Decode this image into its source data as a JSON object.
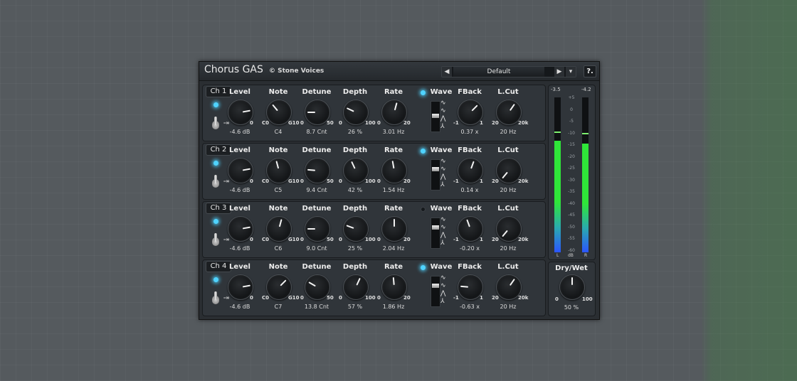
{
  "app": {
    "title": "Chorus GAS",
    "vendor": "© Stone Voices",
    "preset": "Default",
    "help": "?.",
    "prev_icon": "◀",
    "next_icon": "▶",
    "menu_icon": "▾"
  },
  "params": [
    "Level",
    "Note",
    "Detune",
    "Depth",
    "Rate",
    "Wave",
    "FBack",
    "L.Cut"
  ],
  "ranges": {
    "level": [
      "-∞",
      "0"
    ],
    "note": [
      "C0",
      "G10"
    ],
    "detune": [
      "0",
      "50"
    ],
    "depth": [
      "0",
      "100"
    ],
    "rate": [
      "0",
      "20"
    ],
    "fback": [
      "-1",
      "1"
    ],
    "lcut": [
      "20",
      "20k"
    ]
  },
  "wave_symbols": [
    "∿",
    "∿",
    "⋀",
    "⅄"
  ],
  "channels": [
    {
      "label": "Ch 1",
      "led": "on",
      "rate_led": "on",
      "level": "-4.6 dB",
      "note": "C4",
      "detune": "8.7 Cnt",
      "depth": "26 %",
      "rate": "3.01 Hz",
      "fback": "0.37 x",
      "lcut": "20 Hz",
      "angles": {
        "level": 80,
        "note": -40,
        "detune": -90,
        "depth": -65,
        "rate": 15,
        "fback": 45,
        "lcut": 35
      },
      "wave_pos": 0.5
    },
    {
      "label": "Ch 2",
      "led": "on",
      "rate_led": "on",
      "level": "-4.6 dB",
      "note": "C5",
      "detune": "9.4 Cnt",
      "depth": "42 %",
      "rate": "1.54 Hz",
      "fback": "0.14 x",
      "lcut": "20 Hz",
      "angles": {
        "level": 80,
        "note": -15,
        "detune": -85,
        "depth": -25,
        "rate": -10,
        "fback": 20,
        "lcut": -140
      },
      "wave_pos": 0.3
    },
    {
      "label": "Ch 3",
      "led": "on",
      "rate_led": "off",
      "level": "-4.6 dB",
      "note": "C6",
      "detune": "9.0 Cnt",
      "depth": "25 %",
      "rate": "2.04 Hz",
      "fback": "-0.20 x",
      "lcut": "20 Hz",
      "angles": {
        "level": 80,
        "note": 15,
        "detune": -90,
        "depth": -70,
        "rate": 0,
        "fback": -20,
        "lcut": -140
      },
      "wave_pos": 0.3
    },
    {
      "label": "Ch 4",
      "led": "on",
      "rate_led": "on",
      "level": "-4.6 dB",
      "note": "C7",
      "detune": "13.8 Cnt",
      "depth": "57 %",
      "rate": "1.86 Hz",
      "fback": "-0.63 x",
      "lcut": "20 Hz",
      "angles": {
        "level": 80,
        "note": 45,
        "detune": -60,
        "depth": 25,
        "rate": -5,
        "fback": -85,
        "lcut": 35
      },
      "wave_pos": 0.3
    }
  ],
  "meter": {
    "top_left": "-3.5",
    "top_right": "-4.2",
    "scale": [
      "+5",
      "0",
      "-5",
      "-10",
      "-15",
      "-20",
      "-25",
      "-30",
      "-35",
      "-40",
      "-45",
      "-50",
      "-55",
      "-60"
    ],
    "bottom_left": "L",
    "bottom_mid": "dB",
    "bottom_right": "R",
    "left_level": 0.72,
    "right_level": 0.7,
    "left_peak": 0.77,
    "right_peak": 0.76
  },
  "drywet": {
    "label": "Dry/Wet",
    "lo": "0",
    "hi": "100",
    "value": "50 %",
    "angle": 0
  }
}
